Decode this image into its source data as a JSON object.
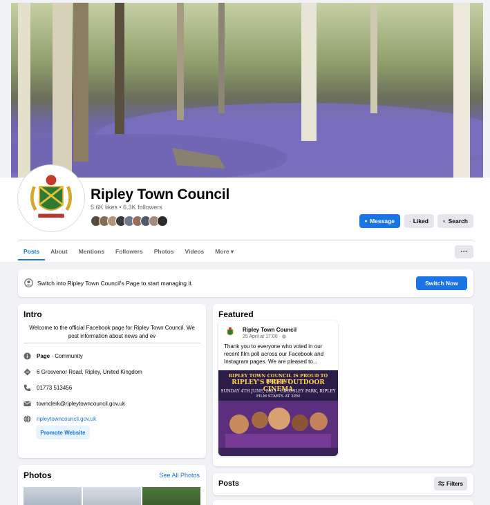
{
  "page": {
    "name": "Ripley Town Council",
    "stats": "5.6K likes • 6.3K followers"
  },
  "actions": {
    "message": "Message",
    "liked": "Liked",
    "search": "Search"
  },
  "tabs": [
    {
      "label": "Posts",
      "active": true
    },
    {
      "label": "About"
    },
    {
      "label": "Mentions"
    },
    {
      "label": "Followers"
    },
    {
      "label": "Photos"
    },
    {
      "label": "Videos"
    },
    {
      "label": "More ▾"
    }
  ],
  "more_menu": "···",
  "switch_banner": {
    "text": "Switch into Ripley Town Council's Page to start managing it.",
    "button": "Switch Now"
  },
  "intro": {
    "title": "Intro",
    "bio": "Welcome to the official Facebook page for Ripley Town Council. We post information about news and ev",
    "category_bold": "Page",
    "category_rest": " · Community",
    "address": "6 Grosvenor Road, Ripley, United Kingdom",
    "phone": "01773 513456",
    "email": "townclerk@ripleytowncouncil.gov.uk",
    "website": "ripleytowncouncil.gov.uk",
    "promote": "Promote Website"
  },
  "photos": {
    "title": "Photos",
    "see_all": "See All Photos"
  },
  "featured": {
    "title": "Featured",
    "post_author": "Ripley Town Council",
    "post_date": "25 April at 17:00 · ",
    "post_text": "Thank you to everyone who voted in our recent film poll across our Facebook and Instagram pages. We are pleased to...",
    "poster_line1": "RIPLEY TOWN COUNCIL IS PROUD TO PRESENT",
    "poster_line2": "RIPLEY'S FREE OUTDOOR CINEMA",
    "poster_line3": "SUNDAY 4TH JUNE, 2023 · CROSSLEY PARK, RIPLEY",
    "poster_line4": "FILM STARTS AT 2PM"
  },
  "posts": {
    "title": "Posts",
    "filters": "Filters"
  },
  "colors": {
    "accent": "#1b74e4",
    "background": "#f0f2f5",
    "secondary_text": "#65676b"
  }
}
